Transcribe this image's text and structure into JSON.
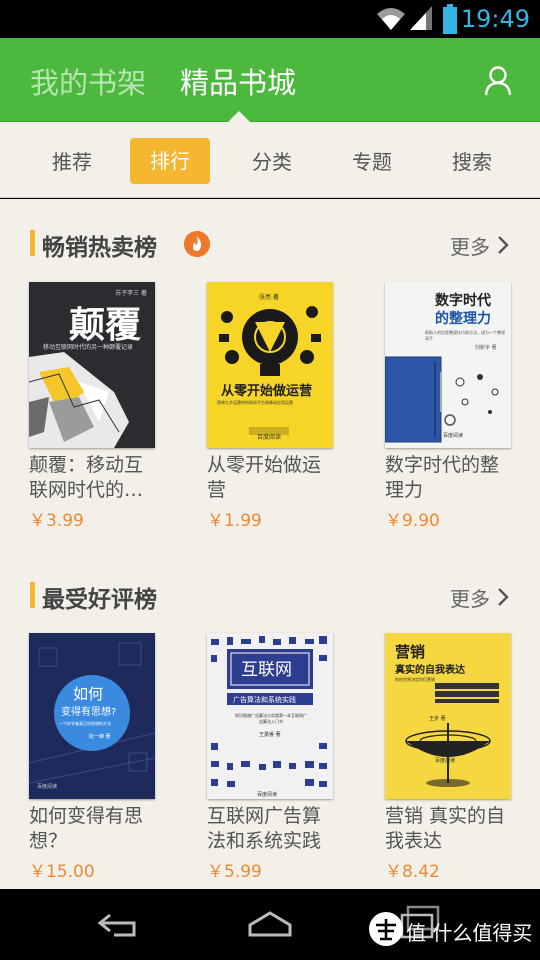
{
  "status": {
    "time": "19:49"
  },
  "header": {
    "tab_mine": "我的书架",
    "tab_store": "精品书城"
  },
  "subnav": {
    "items": [
      "推荐",
      "排行",
      "分类",
      "专题",
      "搜索"
    ],
    "active": "排行"
  },
  "sections": [
    {
      "title": "畅销热卖榜",
      "more": "更多",
      "books": [
        {
          "title_line1": "颠覆：移动互",
          "title_line2": "联网时代的…",
          "price": "￥3.99",
          "cover_title": "颠覆",
          "cover_subtitle": "移动互联网时代的另一种颠覆记录",
          "cover_author": "苏子李三 著"
        },
        {
          "title_line1": "从零开始做运",
          "title_line2": "营",
          "price": "￥1.99",
          "cover_title": "从零开始做运营",
          "cover_subtitle": "简单九步运营你的网站平台和移动应用运营",
          "cover_author": "张亮 著",
          "cover_publisher": "百度阅读"
        },
        {
          "title_line1": "数字时代的整",
          "title_line2": "理力",
          "price": "￥9.90",
          "cover_title_line1": "数字时代",
          "cover_title_line2": "的整理力",
          "cover_subtitle": "帮助人的信息整理技巧和方法，成为一个整理高手",
          "cover_author": "刘新宇 著",
          "cover_publisher": "百度阅读"
        }
      ]
    },
    {
      "title": "最受好评榜",
      "more": "更多",
      "books": [
        {
          "title_line1": "如何变得有思",
          "title_line2": "想？",
          "price": "￥15.00",
          "cover_title_line1": "如何",
          "cover_title_line2": "变得有思想?",
          "cover_subtitle": "一个好学者真正的思想的方法",
          "cover_author": "阮一峰 著",
          "cover_publisher": "百度阅读"
        },
        {
          "title_line1": "互联网广告算",
          "title_line2": "法和系统实践",
          "price": "￥5.99",
          "cover_title": "互联网",
          "cover_subtitle": "广告算法和系统实践",
          "cover_desc": "知识图谱广告算法与实践第一本互联网广告算法入门书",
          "cover_author": "王勇睿 著",
          "cover_publisher": "百度阅读"
        },
        {
          "title_line1": "营销 真实的自",
          "title_line2": "我表达",
          "price": "￥8.42",
          "cover_title_line1": "营销",
          "cover_title_line2": "真实的自我表达",
          "cover_subtitle": "你的世界决定你们营销",
          "cover_author": "王步 著",
          "cover_publisher": "百度阅读"
        }
      ]
    }
  ],
  "watermark": "值 什么值得买",
  "colors": {
    "green": "#4cb93e",
    "accent": "#f5b630",
    "price": "#ec8a34",
    "background": "#f3efe9",
    "status_blue": "#33b5e5"
  }
}
